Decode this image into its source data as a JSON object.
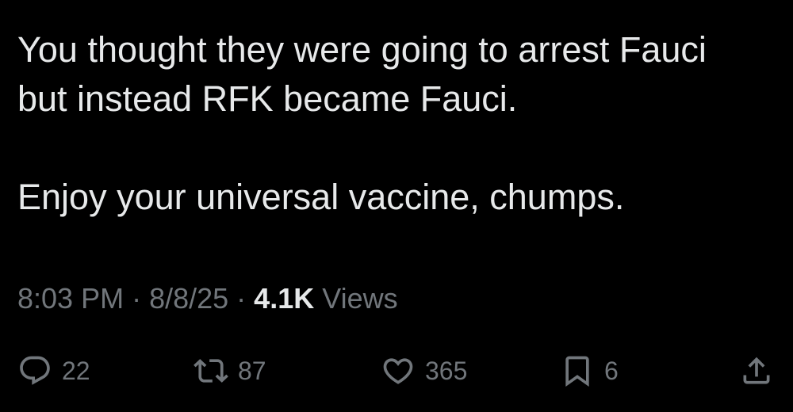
{
  "tweet": {
    "text": "You thought they were going to arrest Fauci\nbut instead RFK became Fauci.\n\nEnjoy your universal vaccine, chumps.",
    "time": "8:03 PM",
    "separator": "·",
    "date": "8/8/25",
    "views_count": "4.1K",
    "views_label": "Views"
  },
  "actions": {
    "reply": {
      "icon": "reply-icon",
      "count": "22"
    },
    "repost": {
      "icon": "repost-icon",
      "count": "87"
    },
    "like": {
      "icon": "heart-icon",
      "count": "365"
    },
    "bookmark": {
      "icon": "bookmark-icon",
      "count": "6"
    },
    "share": {
      "icon": "share-icon"
    }
  },
  "colors": {
    "background": "#000000",
    "text": "#e7e9ea",
    "muted": "#71767b"
  }
}
